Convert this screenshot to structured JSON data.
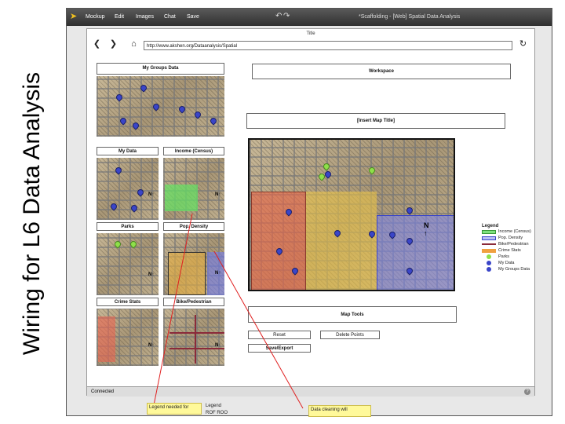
{
  "slide": {
    "vertical_title": "Wiring for L6 Data Analysis"
  },
  "app": {
    "menu": [
      "Mockup",
      "Edit",
      "Images",
      "Chat",
      "Save"
    ],
    "undo_icon": "undo-icon",
    "redo_icon": "redo-icon",
    "document_title": "*Scaffolding - [Web] Spatial Data Analysis"
  },
  "window": {
    "title": "Title",
    "url": "http://www.akshen.org/Dataanalysis/Spatial",
    "back_icon": "back-arrow-icon",
    "forward_icon": "forward-arrow-icon",
    "home_icon": "home-icon",
    "refresh_icon": "refresh-icon"
  },
  "left_panel": {
    "group_label": "My Groups Data",
    "thumbs": [
      "My Data",
      "Income (Census)",
      "Parks",
      "Pop. Density",
      "Crime Stats",
      "Bike/Pedestrian"
    ]
  },
  "workspace": {
    "label": "Workspace",
    "map_title": "[Insert Map Title]"
  },
  "legend": {
    "title": "Legend",
    "items": [
      {
        "label": "Income (Census)",
        "color": "#7ee07e"
      },
      {
        "label": "Pop. Density",
        "color": "#7b86e8"
      },
      {
        "label": "Bike/Pedestrian",
        "color": "#8b2a3a"
      },
      {
        "label": "Crime Stats",
        "color": "#f0a040"
      },
      {
        "label": "Parks",
        "color": "#8fe04a"
      },
      {
        "label": "My Data",
        "color": "#3a45c8"
      },
      {
        "label": "My Groups Data",
        "color": "#3a45c8"
      }
    ]
  },
  "tools": {
    "label": "Map Tools",
    "reset": "Reset",
    "delete": "Delete Points",
    "save": "Save/Export"
  },
  "status": {
    "text": "Connected"
  },
  "notes": {
    "left": "Legend needed for",
    "left_after": "Legend",
    "left_after2": "ROF ROO",
    "right": "Data cleaning will"
  }
}
